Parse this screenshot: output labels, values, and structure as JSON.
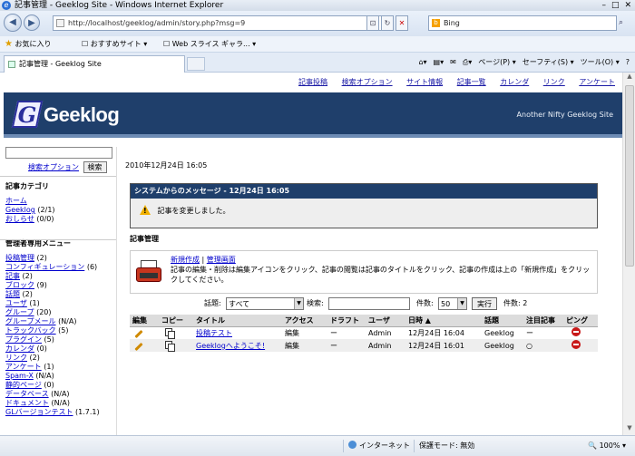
{
  "window": {
    "title": "記事管理 - Geeklog Site - Windows Internet Explorer",
    "min": "–",
    "max": "□",
    "close": "✕"
  },
  "address": {
    "url": "http://localhost/geeklog/admin/story.php?msg=9",
    "search_engine": "Bing"
  },
  "favorites": {
    "favorites_label": "お気に入り",
    "suggested": "おすすめサイト ▾",
    "webslice": "Web スライス ギャラ... ▾"
  },
  "tab": {
    "title": "記事管理 - Geeklog Site"
  },
  "commands": {
    "page": "ページ(P) ▾",
    "safety": "セーフティ(S) ▾",
    "tools": "ツール(O) ▾",
    "help": "?"
  },
  "topnav": [
    "記事投稿",
    "検索オプション",
    "サイト情報",
    "記事一覧",
    "カレンダ",
    "リンク",
    "アンケート"
  ],
  "header": {
    "logo_initial": "G",
    "logo_text": "Geeklog",
    "slogan": "Another Nifty Geeklog Site"
  },
  "sidebar": {
    "search_options": "検索オプション",
    "search_button": "検索",
    "categories_title": "記事カテゴリ",
    "categories": [
      {
        "label": "ホーム",
        "count": ""
      },
      {
        "label": "Geeklog",
        "count": "(2/1)"
      },
      {
        "label": "おしらせ",
        "count": "(0/0)"
      }
    ],
    "admin_title": "管理者専用メニュー",
    "admin_items": [
      {
        "label": "投稿管理",
        "count": "(2)"
      },
      {
        "label": "コンフィギュレーション",
        "count": "(6)"
      },
      {
        "label": "記事",
        "count": "(2)"
      },
      {
        "label": "ブロック",
        "count": "(9)"
      },
      {
        "label": "話題",
        "count": "(2)"
      },
      {
        "label": "ユーザ",
        "count": "(1)"
      },
      {
        "label": "グループ",
        "count": "(20)"
      },
      {
        "label": "グループメール",
        "count": "(N/A)"
      },
      {
        "label": "トラックバック",
        "count": "(5)"
      },
      {
        "label": "プラグイン",
        "count": "(5)"
      },
      {
        "label": "カレンダ",
        "count": "(0)"
      },
      {
        "label": "リンク",
        "count": "(2)"
      },
      {
        "label": "アンケート",
        "count": "(1)"
      },
      {
        "label": "Spam-X",
        "count": "(N/A)"
      },
      {
        "label": "静的ページ",
        "count": "(0)"
      },
      {
        "label": "データベース",
        "count": "(N/A)"
      },
      {
        "label": "ドキュメント",
        "count": "(N/A)"
      },
      {
        "label": "GLバージョンテスト",
        "count": "(1.7.1)"
      }
    ]
  },
  "main": {
    "date": "2010年12月24日  16:05",
    "system_message_title": "システムからのメッセージ - 12月24日 16:05",
    "system_message": "記事を変更しました。",
    "section_title": "記事管理",
    "link_new": "新規作成",
    "link_sep": "|",
    "link_admin": "管理画面",
    "help_text": "記事の編集・削除は編集アイコンをクリック、記事の閲覧は記事のタイトルをクリック、記事の作成は上の「新規作成」をクリックしてください。",
    "filter": {
      "topic_label": "話題:",
      "topic_value": "すべて",
      "search_label": "検索:",
      "search_value": "",
      "count_label": "件数:",
      "count_value": "50",
      "run_button": "実行",
      "result": "件数: 2"
    },
    "columns": [
      "編集",
      "コピー",
      "タイトル",
      "アクセス",
      "ドラフト",
      "ユーザ",
      "日時 ▲",
      "話題",
      "注目記事",
      "ピング"
    ],
    "rows": [
      {
        "title": "投稿テスト",
        "access": "編集",
        "draft": "ー",
        "user": "Admin",
        "date": "12月24日 16:04",
        "topic": "Geeklog",
        "featured": "ー"
      },
      {
        "title": "Geeklogへようこそ!",
        "access": "編集",
        "draft": "ー",
        "user": "Admin",
        "date": "12月24日 16:01",
        "topic": "Geeklog",
        "featured": "○"
      }
    ]
  },
  "status": {
    "zone": "インターネット",
    "protected_mode": "保護モード: 無効",
    "zoom": "100%"
  }
}
